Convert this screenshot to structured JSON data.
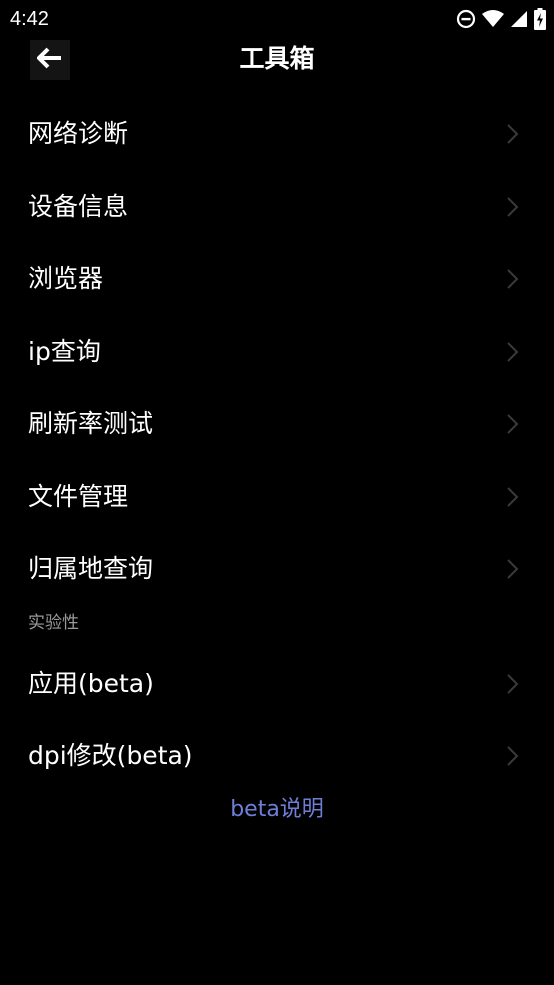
{
  "status_bar": {
    "time": "4:42",
    "icons": [
      "do-not-disturb-icon",
      "wifi-icon",
      "cellular-signal-icon",
      "battery-charging-icon"
    ]
  },
  "app_bar": {
    "back_icon": "arrow-left-icon",
    "title": "工具箱"
  },
  "menu": {
    "items": [
      {
        "label": "网络诊断"
      },
      {
        "label": "设备信息"
      },
      {
        "label": "浏览器"
      },
      {
        "label": "ip查询"
      },
      {
        "label": "刷新率测试"
      },
      {
        "label": "文件管理"
      },
      {
        "label": "归属地查询"
      }
    ],
    "section_label": "实验性",
    "beta_items": [
      {
        "label": "应用(beta)"
      },
      {
        "label": "dpi修改(beta)"
      }
    ]
  },
  "beta_link": "beta说明",
  "colors": {
    "background": "#000000",
    "text": "#ffffff",
    "secondary_text": "#9a9a9a",
    "chevron": "#3a3a3a",
    "link": "#6f7fd8"
  }
}
